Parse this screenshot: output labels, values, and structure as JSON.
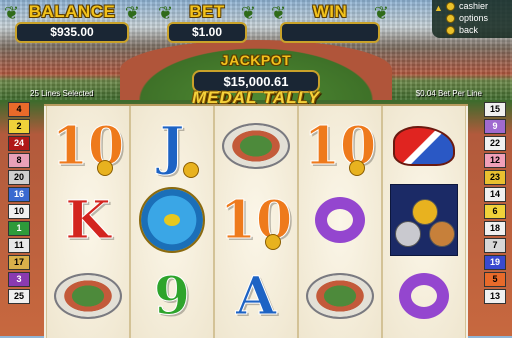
{
  "header": {
    "balance_label": "BALANCE",
    "balance_value": "$935.00",
    "bet_label": "BET",
    "bet_value": "$1.00",
    "win_label": "WIN",
    "win_value": ""
  },
  "menu": {
    "items": [
      {
        "label": "cashier",
        "icon": "gold-dot-icon"
      },
      {
        "label": "options",
        "icon": "gold-dot-icon"
      },
      {
        "label": "back",
        "icon": "gold-dot-icon"
      }
    ]
  },
  "jackpot": {
    "label": "JACKPOT",
    "value": "$15,000.61"
  },
  "info": {
    "lines_selected": "25 Lines Selected",
    "game_title": "MEDAL TALLY",
    "bet_per_line": "$0.04 Bet Per Line"
  },
  "reels": [
    {
      "symbols": [
        "10",
        "K",
        "stadium-icon"
      ]
    },
    {
      "symbols": [
        "J",
        "swimmer-icon",
        "9"
      ]
    },
    {
      "symbols": [
        "stadium-icon",
        "10",
        "A"
      ]
    },
    {
      "symbols": [
        "10",
        "Q",
        "stadium-icon"
      ]
    },
    {
      "symbols": [
        "shoe-icon",
        "medals-icon",
        "Q"
      ]
    }
  ],
  "paylines": {
    "left": [
      "4",
      "2",
      "24",
      "8",
      "20",
      "16",
      "10",
      "1",
      "11",
      "17",
      "3",
      "25"
    ],
    "right": [
      "15",
      "9",
      "22",
      "12",
      "23",
      "14",
      "6",
      "18",
      "7",
      "19",
      "5",
      "13"
    ]
  },
  "colors": {
    "gold": "#f2c21b",
    "value_box": "#1a2634",
    "reel_bg": "#f4efe2"
  }
}
